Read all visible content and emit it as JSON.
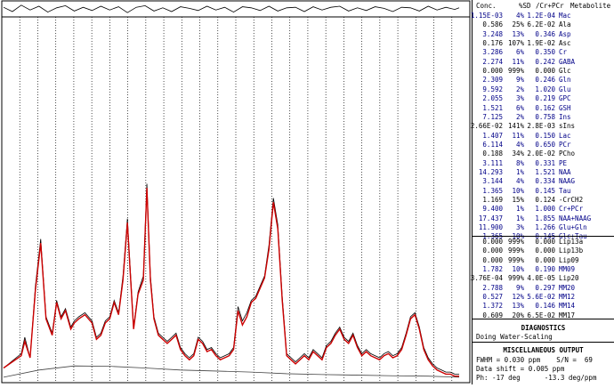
{
  "table_header": {
    "conc": "Conc.",
    "sd": "%SD",
    "ratio": "/Cr+PCr",
    "met": "Metabolite"
  },
  "metabolites": [
    {
      "conc": "1.15E-03",
      "sd": "4%",
      "ratio": "1.2E-04",
      "name": "Mac",
      "color": "blue"
    },
    {
      "conc": "0.586",
      "sd": "25%",
      "ratio": "6.2E-02",
      "name": "Ala",
      "color": "black"
    },
    {
      "conc": "3.248",
      "sd": "13%",
      "ratio": "0.346",
      "name": "Asp",
      "color": "blue"
    },
    {
      "conc": "0.176",
      "sd": "107%",
      "ratio": "1.9E-02",
      "name": "Asc",
      "color": "black"
    },
    {
      "conc": "3.286",
      "sd": "6%",
      "ratio": "0.350",
      "name": "Cr",
      "color": "blue"
    },
    {
      "conc": "2.274",
      "sd": "11%",
      "ratio": "0.242",
      "name": "GABA",
      "color": "blue"
    },
    {
      "conc": "0.000",
      "sd": "999%",
      "ratio": "0.000",
      "name": "Glc",
      "color": "black"
    },
    {
      "conc": "2.309",
      "sd": "9%",
      "ratio": "0.246",
      "name": "Gln",
      "color": "blue"
    },
    {
      "conc": "9.592",
      "sd": "2%",
      "ratio": "1.020",
      "name": "Glu",
      "color": "blue"
    },
    {
      "conc": "2.055",
      "sd": "3%",
      "ratio": "0.219",
      "name": "GPC",
      "color": "blue"
    },
    {
      "conc": "1.521",
      "sd": "6%",
      "ratio": "0.162",
      "name": "GSH",
      "color": "blue"
    },
    {
      "conc": "7.125",
      "sd": "2%",
      "ratio": "0.758",
      "name": "Ins",
      "color": "blue"
    },
    {
      "conc": "2.66E-02",
      "sd": "141%",
      "ratio": "2.8E-03",
      "name": "sIns",
      "color": "black"
    },
    {
      "conc": "1.407",
      "sd": "11%",
      "ratio": "0.150",
      "name": "Lac",
      "color": "blue"
    },
    {
      "conc": "6.114",
      "sd": "4%",
      "ratio": "0.650",
      "name": "PCr",
      "color": "blue"
    },
    {
      "conc": "0.188",
      "sd": "34%",
      "ratio": "2.0E-02",
      "name": "PCho",
      "color": "black"
    },
    {
      "conc": "3.111",
      "sd": "8%",
      "ratio": "0.331",
      "name": "PE",
      "color": "blue"
    },
    {
      "conc": "14.293",
      "sd": "1%",
      "ratio": "1.521",
      "name": "NAA",
      "color": "blue"
    },
    {
      "conc": "3.144",
      "sd": "4%",
      "ratio": "0.334",
      "name": "NAAG",
      "color": "blue"
    },
    {
      "conc": "1.365",
      "sd": "10%",
      "ratio": "0.145",
      "name": "Tau",
      "color": "blue"
    },
    {
      "conc": "1.169",
      "sd": "15%",
      "ratio": "0.124",
      "name": "-CrCH2",
      "color": "black"
    },
    {
      "conc": "9.400",
      "sd": "1%",
      "ratio": "1.000",
      "name": "Cr+PCr",
      "color": "blue"
    },
    {
      "conc": "17.437",
      "sd": "1%",
      "ratio": "1.855",
      "name": "NAA+NAAG",
      "color": "blue"
    },
    {
      "conc": "11.900",
      "sd": "3%",
      "ratio": "1.266",
      "name": "Glu+Gln",
      "color": "blue"
    },
    {
      "conc": "1.365",
      "sd": "10%",
      "ratio": "0.145",
      "name": "Glc+Tau",
      "color": "blue"
    }
  ],
  "lipids": [
    {
      "conc": "0.000",
      "sd": "999%",
      "ratio": "0.000",
      "name": "Lip13a",
      "color": "black"
    },
    {
      "conc": "0.000",
      "sd": "999%",
      "ratio": "0.000",
      "name": "Lip13b",
      "color": "black"
    },
    {
      "conc": "0.000",
      "sd": "999%",
      "ratio": "0.000",
      "name": "Lip09",
      "color": "black"
    },
    {
      "conc": "1.782",
      "sd": "10%",
      "ratio": "0.190",
      "name": "MM09",
      "color": "blue"
    },
    {
      "conc": "3.76E-04",
      "sd": "999%",
      "ratio": "4.0E-05",
      "name": "Lip20",
      "color": "black"
    },
    {
      "conc": "2.788",
      "sd": "9%",
      "ratio": "0.297",
      "name": "MM20",
      "color": "blue"
    },
    {
      "conc": "0.527",
      "sd": "12%",
      "ratio": "5.6E-02",
      "name": "MM12",
      "color": "blue"
    },
    {
      "conc": "1.372",
      "sd": "13%",
      "ratio": "0.146",
      "name": "MM14",
      "color": "blue"
    },
    {
      "conc": "0.609",
      "sd": "20%",
      "ratio": "6.5E-02",
      "name": "MM17",
      "color": "black"
    }
  ],
  "diagnostics": {
    "title": "DIAGNOSTICS",
    "text": "Doing Water-Scaling"
  },
  "misc": {
    "title": "MISCELLANEOUS OUTPUT",
    "line1": "FWHM = 0.030 ppm    S/N =  69",
    "line2": "Data shift = 0.005 ppm",
    "line3": "Ph: -17 deg      -13.3 deg/ppm"
  },
  "chart_data": {
    "type": "line",
    "series": [
      {
        "role": "data",
        "color": "#000000",
        "x": [
          0,
          20,
          24,
          30,
          36,
          42,
          48,
          55,
          60,
          65,
          70,
          76,
          80,
          85,
          92,
          100,
          105,
          110,
          115,
          120,
          125,
          130,
          135,
          140,
          143,
          147,
          152,
          158,
          162,
          166,
          170,
          175,
          180,
          185,
          190,
          195,
          200,
          205,
          210,
          215,
          220,
          225,
          230,
          235,
          240,
          245,
          250,
          255,
          260,
          265,
          270,
          275,
          280,
          285,
          290,
          295,
          300,
          305,
          310,
          315,
          320,
          325,
          330,
          335,
          340,
          345,
          350,
          355,
          360,
          365,
          370,
          375,
          380,
          385,
          390,
          395,
          400,
          405,
          410,
          415,
          420,
          425,
          430,
          435,
          440,
          445,
          450,
          455,
          460,
          465,
          470,
          475,
          480,
          485,
          490,
          495,
          500,
          505,
          510,
          515
        ],
        "y": [
          0.05,
          0.12,
          0.2,
          0.1,
          0.45,
          0.68,
          0.3,
          0.22,
          0.38,
          0.3,
          0.34,
          0.25,
          0.28,
          0.3,
          0.32,
          0.28,
          0.2,
          0.22,
          0.28,
          0.3,
          0.38,
          0.32,
          0.5,
          0.78,
          0.55,
          0.25,
          0.42,
          0.5,
          0.95,
          0.5,
          0.3,
          0.22,
          0.2,
          0.18,
          0.2,
          0.22,
          0.15,
          0.12,
          0.1,
          0.12,
          0.2,
          0.18,
          0.14,
          0.15,
          0.12,
          0.1,
          0.11,
          0.12,
          0.15,
          0.35,
          0.28,
          0.32,
          0.38,
          0.4,
          0.45,
          0.5,
          0.65,
          0.88,
          0.75,
          0.4,
          0.12,
          0.1,
          0.08,
          0.1,
          0.12,
          0.1,
          0.14,
          0.12,
          0.1,
          0.16,
          0.18,
          0.22,
          0.25,
          0.2,
          0.18,
          0.22,
          0.16,
          0.12,
          0.14,
          0.12,
          0.11,
          0.1,
          0.12,
          0.13,
          0.11,
          0.12,
          0.15,
          0.22,
          0.3,
          0.32,
          0.25,
          0.15,
          0.1,
          0.07,
          0.05,
          0.04,
          0.03,
          0.03,
          0.02,
          0.02
        ]
      },
      {
        "role": "fit",
        "color": "#cc0000",
        "x": [
          0,
          20,
          24,
          30,
          36,
          42,
          48,
          55,
          60,
          65,
          70,
          76,
          80,
          85,
          92,
          100,
          105,
          110,
          115,
          120,
          125,
          130,
          135,
          140,
          143,
          147,
          152,
          158,
          162,
          166,
          170,
          175,
          180,
          185,
          190,
          195,
          200,
          205,
          210,
          215,
          220,
          225,
          230,
          235,
          240,
          245,
          250,
          255,
          260,
          265,
          270,
          275,
          280,
          285,
          290,
          295,
          300,
          305,
          310,
          315,
          320,
          325,
          330,
          335,
          340,
          345,
          350,
          355,
          360,
          365,
          370,
          375,
          380,
          385,
          390,
          395,
          400,
          405,
          410,
          415,
          420,
          425,
          430,
          435,
          440,
          445,
          450,
          455,
          460,
          465,
          470,
          475,
          480,
          485,
          490,
          495,
          500,
          505,
          510,
          515
        ],
        "y": [
          0.05,
          0.11,
          0.18,
          0.1,
          0.43,
          0.66,
          0.29,
          0.21,
          0.37,
          0.29,
          0.33,
          0.24,
          0.27,
          0.29,
          0.31,
          0.27,
          0.19,
          0.21,
          0.27,
          0.29,
          0.37,
          0.31,
          0.48,
          0.76,
          0.53,
          0.24,
          0.41,
          0.48,
          0.93,
          0.48,
          0.29,
          0.21,
          0.19,
          0.17,
          0.19,
          0.21,
          0.14,
          0.11,
          0.09,
          0.11,
          0.19,
          0.17,
          0.13,
          0.14,
          0.11,
          0.09,
          0.1,
          0.11,
          0.14,
          0.33,
          0.26,
          0.3,
          0.37,
          0.39,
          0.44,
          0.49,
          0.63,
          0.86,
          0.73,
          0.38,
          0.11,
          0.09,
          0.07,
          0.09,
          0.11,
          0.09,
          0.13,
          0.11,
          0.09,
          0.15,
          0.17,
          0.21,
          0.24,
          0.19,
          0.17,
          0.21,
          0.15,
          0.11,
          0.13,
          0.11,
          0.1,
          0.09,
          0.11,
          0.12,
          0.1,
          0.11,
          0.14,
          0.21,
          0.29,
          0.31,
          0.24,
          0.14,
          0.09,
          0.06,
          0.04,
          0.03,
          0.02,
          0.02,
          0.01,
          0.01
        ]
      },
      {
        "role": "baseline",
        "color": "#444444",
        "x": [
          0,
          40,
          80,
          120,
          160,
          200,
          240,
          280,
          320,
          360,
          400,
          440,
          480,
          515
        ],
        "y": [
          0.005,
          0.04,
          0.06,
          0.058,
          0.05,
          0.04,
          0.035,
          0.03,
          0.022,
          0.018,
          0.015,
          0.012,
          0.01,
          0.005
        ]
      },
      {
        "role": "residual",
        "color": "#000000",
        "x": [
          0,
          10,
          20,
          30,
          40,
          50,
          60,
          70,
          80,
          90,
          100,
          110,
          120,
          130,
          140,
          150,
          160,
          170,
          180,
          190,
          200,
          210,
          220,
          230,
          240,
          250,
          260,
          270,
          280,
          290,
          300,
          310,
          320,
          330,
          340,
          350,
          360,
          370,
          380,
          390,
          400,
          410,
          420,
          430,
          440,
          450,
          460,
          470,
          480,
          490,
          500,
          510,
          515
        ],
        "y": [
          0.3,
          -0.5,
          0.7,
          -0.2,
          0.5,
          -0.6,
          0.2,
          0.6,
          -0.4,
          0.3,
          -0.3,
          0.5,
          -0.2,
          0.4,
          -0.7,
          0.3,
          0.6,
          -0.4,
          0.2,
          -0.5,
          0.4,
          0.1,
          -0.3,
          0.5,
          -0.2,
          0.3,
          -0.6,
          0.4,
          0.2,
          -0.3,
          0.5,
          -0.4,
          0.2,
          0.3,
          -0.5,
          0.4,
          -0.2,
          0.3,
          0.5,
          -0.4,
          0.2,
          -0.3,
          0.4,
          0.1,
          -0.5,
          0.3,
          0.2,
          -0.4,
          0.5,
          -0.2,
          0.3,
          -0.1,
          0.2
        ]
      }
    ],
    "ylim": [
      0,
      1
    ],
    "grid": "dotted vertical",
    "grid_count": 25
  }
}
